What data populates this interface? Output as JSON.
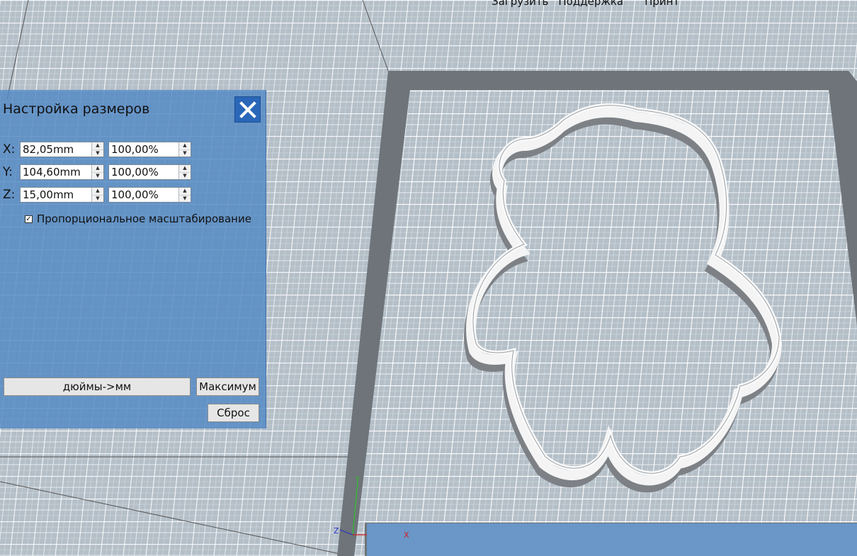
{
  "top_menu": {
    "items": [
      "Загрузить",
      "Поддержка",
      "Принт"
    ]
  },
  "panel": {
    "title": "Настройка размеров",
    "rows": [
      {
        "axis": "X:",
        "mm": "82,05mm",
        "pct": "100,00%"
      },
      {
        "axis": "Y:",
        "mm": "104,60mm",
        "pct": "100,00%"
      },
      {
        "axis": "Z:",
        "mm": "15,00mm",
        "pct": "100,00%"
      }
    ],
    "proportional_label": "Пропорциональное масштабирование",
    "proportional_checked": true,
    "inch_to_mm_label": "дюймы->мм",
    "max_label": "Максимум",
    "reset_label": "Сброс"
  },
  "axes": {
    "x": "X",
    "y": "Y",
    "z": "Z"
  },
  "colors": {
    "panel_bg": "#5087c3",
    "close_btn": "#2a67b8",
    "bed_frame": "#6e7479",
    "grid": "#ffffff",
    "bg": "#b9c4cd",
    "model": "#f5f5f5",
    "model_shadow": "#8a8e92"
  }
}
